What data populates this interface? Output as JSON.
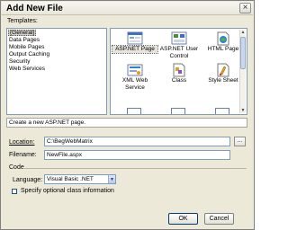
{
  "window": {
    "title": "Add New File",
    "close_glyph": "×"
  },
  "templates_label": "Templates:",
  "categories": [
    "(General)",
    "Data Pages",
    "Mobile Pages",
    "Output Caching",
    "Security",
    "Web Services"
  ],
  "templates": [
    {
      "label": "ASP.NET Page",
      "icon": "aspnet-page-icon"
    },
    {
      "label": "ASP.NET User Control",
      "icon": "user-control-icon"
    },
    {
      "label": "HTML Page",
      "icon": "html-page-icon"
    },
    {
      "label": "XML Web Service",
      "icon": "web-service-icon"
    },
    {
      "label": "Class",
      "icon": "class-icon"
    },
    {
      "label": "Style Sheet",
      "icon": "style-sheet-icon"
    }
  ],
  "description": "Create a new ASP.NET page.",
  "location": {
    "label": "Location:",
    "value": "C:\\BegWebMatrix",
    "browse_label": "..."
  },
  "filename": {
    "label": "Filename:",
    "value": "NewFile.aspx"
  },
  "code_section": "Code",
  "language": {
    "label": "Language:",
    "value": "Visual Basic .NET"
  },
  "class_info_checkbox": "Specify optional class information",
  "ok_label": "OK",
  "cancel_label": "Cancel",
  "accent_colors": {
    "titlebar": "#ece9d8",
    "selection": "#d4d0c8",
    "border": "#7f9db9"
  }
}
